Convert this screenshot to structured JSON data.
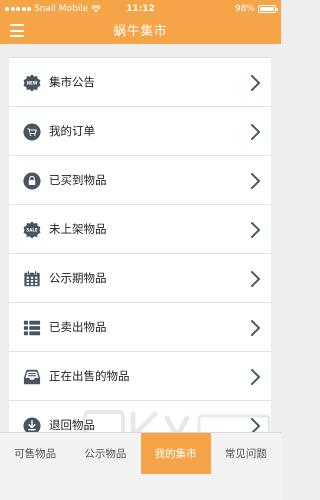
{
  "status_bar": {
    "carrier": "Snail Mobile",
    "time": "11:12",
    "battery": "98%"
  },
  "header": {
    "title": "蜗牛集市",
    "menu_icon": "hamburger-icon"
  },
  "menu": {
    "items": [
      {
        "label": "集市公告",
        "icon": "new-badge-icon"
      },
      {
        "label": "我的订单",
        "icon": "cart-icon"
      },
      {
        "label": "已买到物品",
        "icon": "lock-icon"
      },
      {
        "label": "未上架物品",
        "icon": "sale-badge-icon"
      },
      {
        "label": "公示期物品",
        "icon": "calendar-icon"
      },
      {
        "label": "已卖出物品",
        "icon": "list-icon"
      },
      {
        "label": "正在出售的物品",
        "icon": "inbox-icon"
      },
      {
        "label": "退回物品",
        "icon": "download-icon"
      }
    ]
  },
  "tabs": [
    {
      "label": "可售物品",
      "active": false
    },
    {
      "label": "公示物品",
      "active": false
    },
    {
      "label": "我的集市",
      "active": true
    },
    {
      "label": "常见问题",
      "active": false
    }
  ],
  "colors": {
    "accent": "#f5a548",
    "icon": "#4a5560",
    "chevron": "#4a5a66"
  }
}
